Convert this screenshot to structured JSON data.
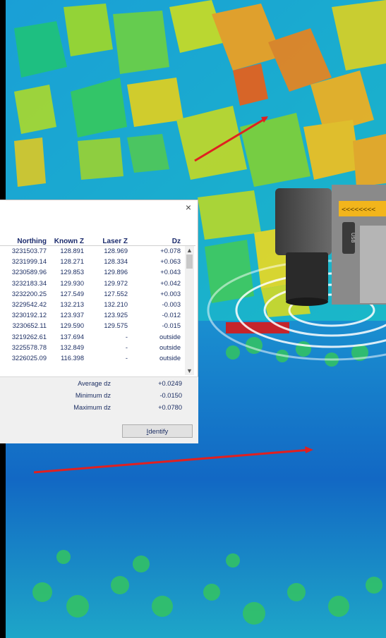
{
  "dialog": {
    "close_glyph": "×",
    "columns": [
      "Northing",
      "Known Z",
      "Laser Z",
      "Dz"
    ],
    "rows": [
      [
        "3231503.77",
        "128.891",
        "128.969",
        "+0.078"
      ],
      [
        "3231999.14",
        "128.271",
        "128.334",
        "+0.063"
      ],
      [
        "3230589.96",
        "129.853",
        "129.896",
        "+0.043"
      ],
      [
        "3232183.34",
        "129.930",
        "129.972",
        "+0.042"
      ],
      [
        "3232200.25",
        "127.549",
        "127.552",
        "+0.003"
      ],
      [
        "3229542.42",
        "132.213",
        "132.210",
        "-0.003"
      ],
      [
        "3230192.12",
        "123.937",
        "123.925",
        "-0.012"
      ],
      [
        "3230652.11",
        "129.590",
        "129.575",
        "-0.015"
      ],
      [
        "3219262.61",
        "137.694",
        "-",
        "outside"
      ],
      [
        "3225578.78",
        "132.849",
        "-",
        "outside"
      ],
      [
        "3226025.09",
        "116.398",
        "-",
        "outside"
      ]
    ],
    "stats": {
      "average_label": "Average dz",
      "average_value": "+0.0249",
      "minimum_label": "Minimum dz",
      "minimum_value": "-0.0150",
      "maximum_label": "Maximum dz",
      "maximum_value": "+0.0780"
    },
    "identify_first": "I",
    "identify_rest": "dentify"
  },
  "background": {
    "scanner_label": "<<<<<<<<",
    "usb_label": "USB"
  },
  "colors": {
    "arrow": "#e02020",
    "scanner_stripe": "#f2b51c"
  }
}
